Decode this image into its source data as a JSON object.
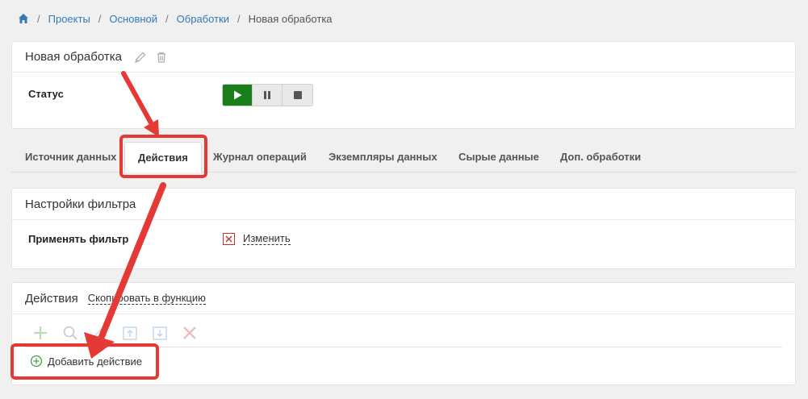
{
  "breadcrumb": {
    "items": [
      "Проекты",
      "Основной",
      "Обработки"
    ],
    "current": "Новая обработка"
  },
  "processing": {
    "title": "Новая обработка",
    "status_label": "Статус"
  },
  "tabs": [
    {
      "label": "Источник данных"
    },
    {
      "label": "Действия",
      "active": true
    },
    {
      "label": "Журнал операций"
    },
    {
      "label": "Экземпляры данных"
    },
    {
      "label": "Сырые данные"
    },
    {
      "label": "Доп. обработки"
    }
  ],
  "filter": {
    "title": "Настройки фильтра",
    "apply_label": "Применять фильтр",
    "change_link": "Изменить"
  },
  "actions": {
    "title": "Действия",
    "copy_link": "Скопировать в функцию",
    "add_button": "Добавить действие"
  },
  "colors": {
    "link": "#337ab7",
    "play": "#1a7e1a",
    "highlight": "#e53935",
    "danger": "#c9302c"
  },
  "icons": [
    "home-icon",
    "pencil-icon",
    "trash-icon",
    "play-icon",
    "pause-icon",
    "stop-icon",
    "x-icon",
    "plus-icon",
    "search-icon",
    "upload-icon",
    "download-icon",
    "close-icon",
    "plus-circle-icon"
  ]
}
